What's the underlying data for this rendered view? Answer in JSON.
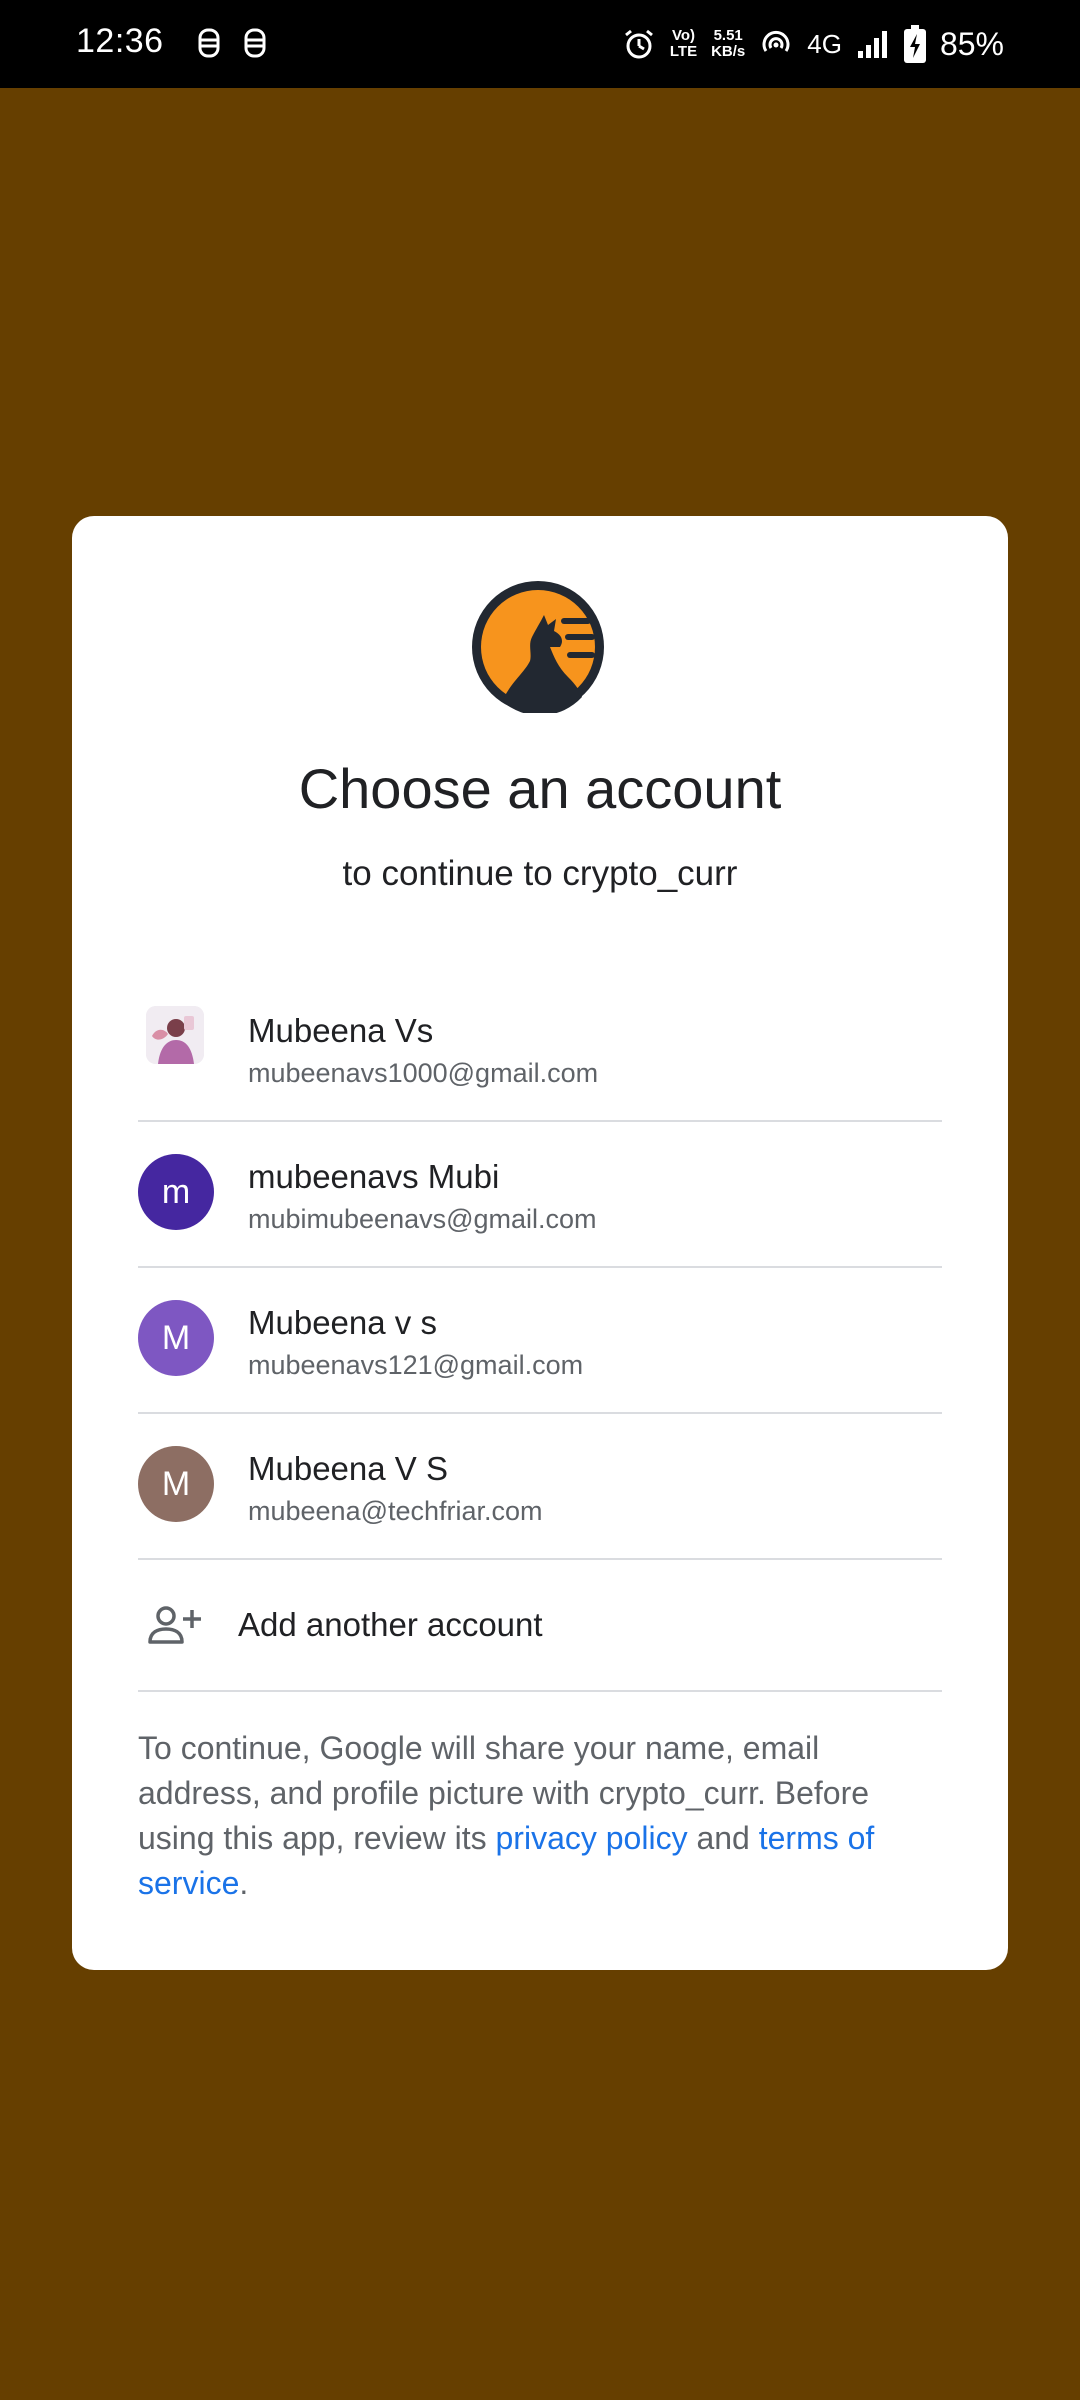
{
  "status_bar": {
    "time": "12:36",
    "volte_top": "Vo)",
    "volte_bottom": "LTE",
    "speed_value": "5.51",
    "speed_unit": "KB/s",
    "network": "4G",
    "battery": "85%"
  },
  "dialog": {
    "title": "Choose an account",
    "subtitle": "to continue to crypto_curr",
    "accounts": [
      {
        "name": "Mubeena Vs",
        "email": "mubeenavs1000@gmail.com",
        "avatar_type": "photo"
      },
      {
        "name": "mubeenavs Mubi",
        "email": "mubimubeenavs@gmail.com",
        "avatar_letter": "m",
        "avatar_color": "#4527a0"
      },
      {
        "name": "Mubeena v s",
        "email": "mubeenavs121@gmail.com",
        "avatar_letter": "M",
        "avatar_color": "#7e57c2"
      },
      {
        "name": "Mubeena V S",
        "email": "mubeena@techfriar.com",
        "avatar_letter": "M",
        "avatar_color": "#8d6e63"
      }
    ],
    "add_account_label": "Add another account",
    "disclaimer": {
      "prefix": "To continue, Google will share your name, email address, and profile picture with crypto_curr. Before using this app, review its ",
      "privacy_link": "privacy policy",
      "middle": " and ",
      "terms_link": "terms of service",
      "suffix": "."
    }
  },
  "colors": {
    "background": "#663f00",
    "link": "#1a73e8",
    "logo_orange": "#f7941d",
    "logo_dark": "#222831"
  },
  "icons": {
    "logo": "wolf-moon-logo",
    "add_account": "person-add-icon"
  }
}
